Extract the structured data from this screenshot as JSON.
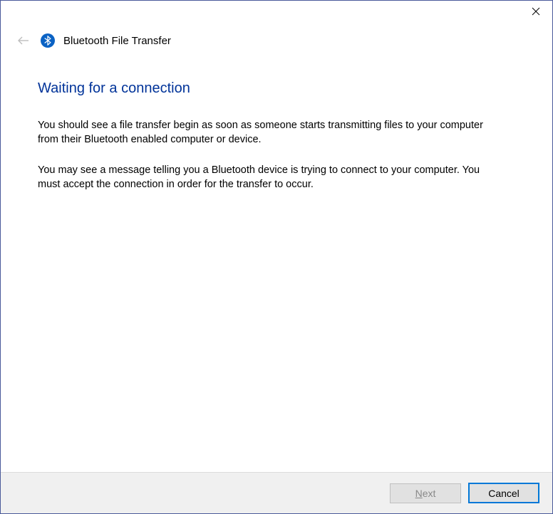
{
  "header": {
    "title": "Bluetooth File Transfer"
  },
  "page": {
    "heading": "Waiting for a connection",
    "paragraph1": "You should see a file transfer begin as soon as someone starts transmitting files to your computer from their Bluetooth enabled computer or device.",
    "paragraph2": "You may see a message telling you a Bluetooth device is trying to connect to your computer. You must accept the connection in order for the transfer to occur."
  },
  "footer": {
    "next_prefix": "N",
    "next_rest": "ext",
    "cancel_label": "Cancel"
  }
}
